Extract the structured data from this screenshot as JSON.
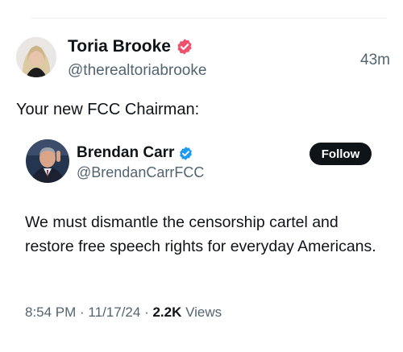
{
  "outer_post": {
    "author_name": "Toria Brooke",
    "handle": "@therealtoriabrooke",
    "time": "43m",
    "text": "Your new FCC Chairman:",
    "verified_badge_color": "#f0506e",
    "avatar_icon": "avatar-photo"
  },
  "quoted_post": {
    "author_name": "Brendan Carr",
    "handle": "@BrendanCarrFCC",
    "follow_label": "Follow",
    "text": "We must dismantle the censorship cartel and restore free speech rights for everyday Americans.",
    "verified_badge_color": "#1d9bf0",
    "avatar_icon": "avatar-photo",
    "meta": {
      "time": "8:54 PM",
      "sep1": " · ",
      "date": "11/17/24",
      "sep2": " · ",
      "views_count": "2.2K",
      "views_label": " Views"
    }
  },
  "colors": {
    "text_primary": "#0f1419",
    "text_secondary": "#536471",
    "follow_bg": "#0f1419"
  }
}
